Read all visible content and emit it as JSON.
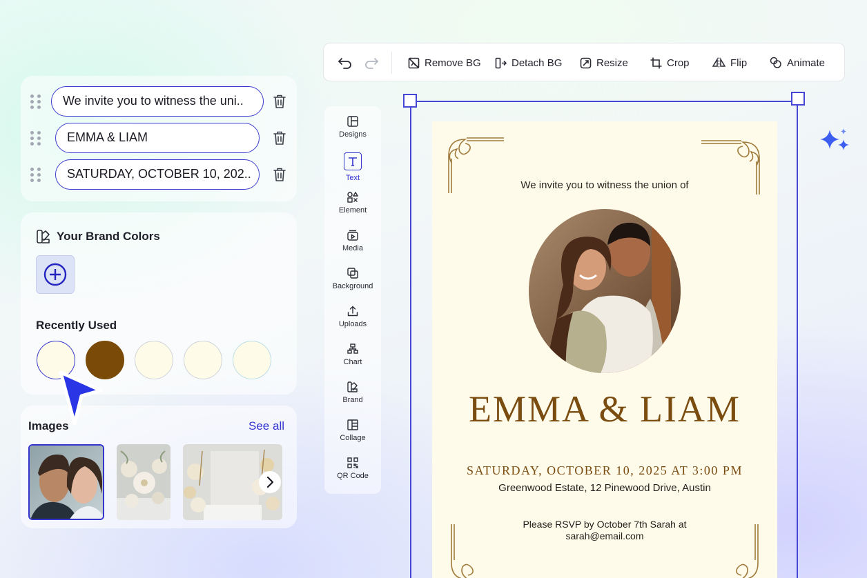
{
  "layers": [
    {
      "text": "We invite you to witness the uni.."
    },
    {
      "text": "EMMA & LIAM"
    },
    {
      "text": "SATURDAY, OCTOBER 10, 202.."
    }
  ],
  "brand": {
    "title": "Your Brand Colors",
    "recent_title": "Recently Used",
    "recent_colors": [
      "#fffbe9",
      "#7a4a08",
      "#fffbe9",
      "#fffbe9",
      "#fffbe9"
    ],
    "selected_index": 0
  },
  "images": {
    "title": "Images",
    "see_all": "See all"
  },
  "toolbar": {
    "remove_bg": "Remove BG",
    "detach_bg": "Detach BG",
    "resize": "Resize",
    "crop": "Crop",
    "flip": "Flip",
    "animate": "Animate"
  },
  "sidebar": {
    "items": [
      {
        "label": "Designs",
        "icon": "layout-icon"
      },
      {
        "label": "Text",
        "icon": "text-icon"
      },
      {
        "label": "Element",
        "icon": "shapes-icon"
      },
      {
        "label": "Media",
        "icon": "media-icon"
      },
      {
        "label": "Background",
        "icon": "background-icon"
      },
      {
        "label": "Uploads",
        "icon": "upload-icon"
      },
      {
        "label": "Chart",
        "icon": "chart-icon"
      },
      {
        "label": "Brand",
        "icon": "brand-icon"
      },
      {
        "label": "Collage",
        "icon": "collage-icon"
      },
      {
        "label": "QR Code",
        "icon": "qr-code-icon"
      }
    ],
    "active": "Text"
  },
  "invitation": {
    "intro": "We invite you to witness the union of",
    "names": "EMMA & LIAM",
    "date": "SATURDAY, OCTOBER 10, 2025 AT 3:00 PM",
    "venue": "Greenwood Estate, 12 Pinewood Drive, Austin",
    "rsvp_line1": "Please RSVP by October 7th Sarah at",
    "rsvp_line2": "sarah@email.com"
  },
  "colors": {
    "accent": "#3434cf",
    "gold": "#7a4c10",
    "paper": "#fffbea"
  }
}
